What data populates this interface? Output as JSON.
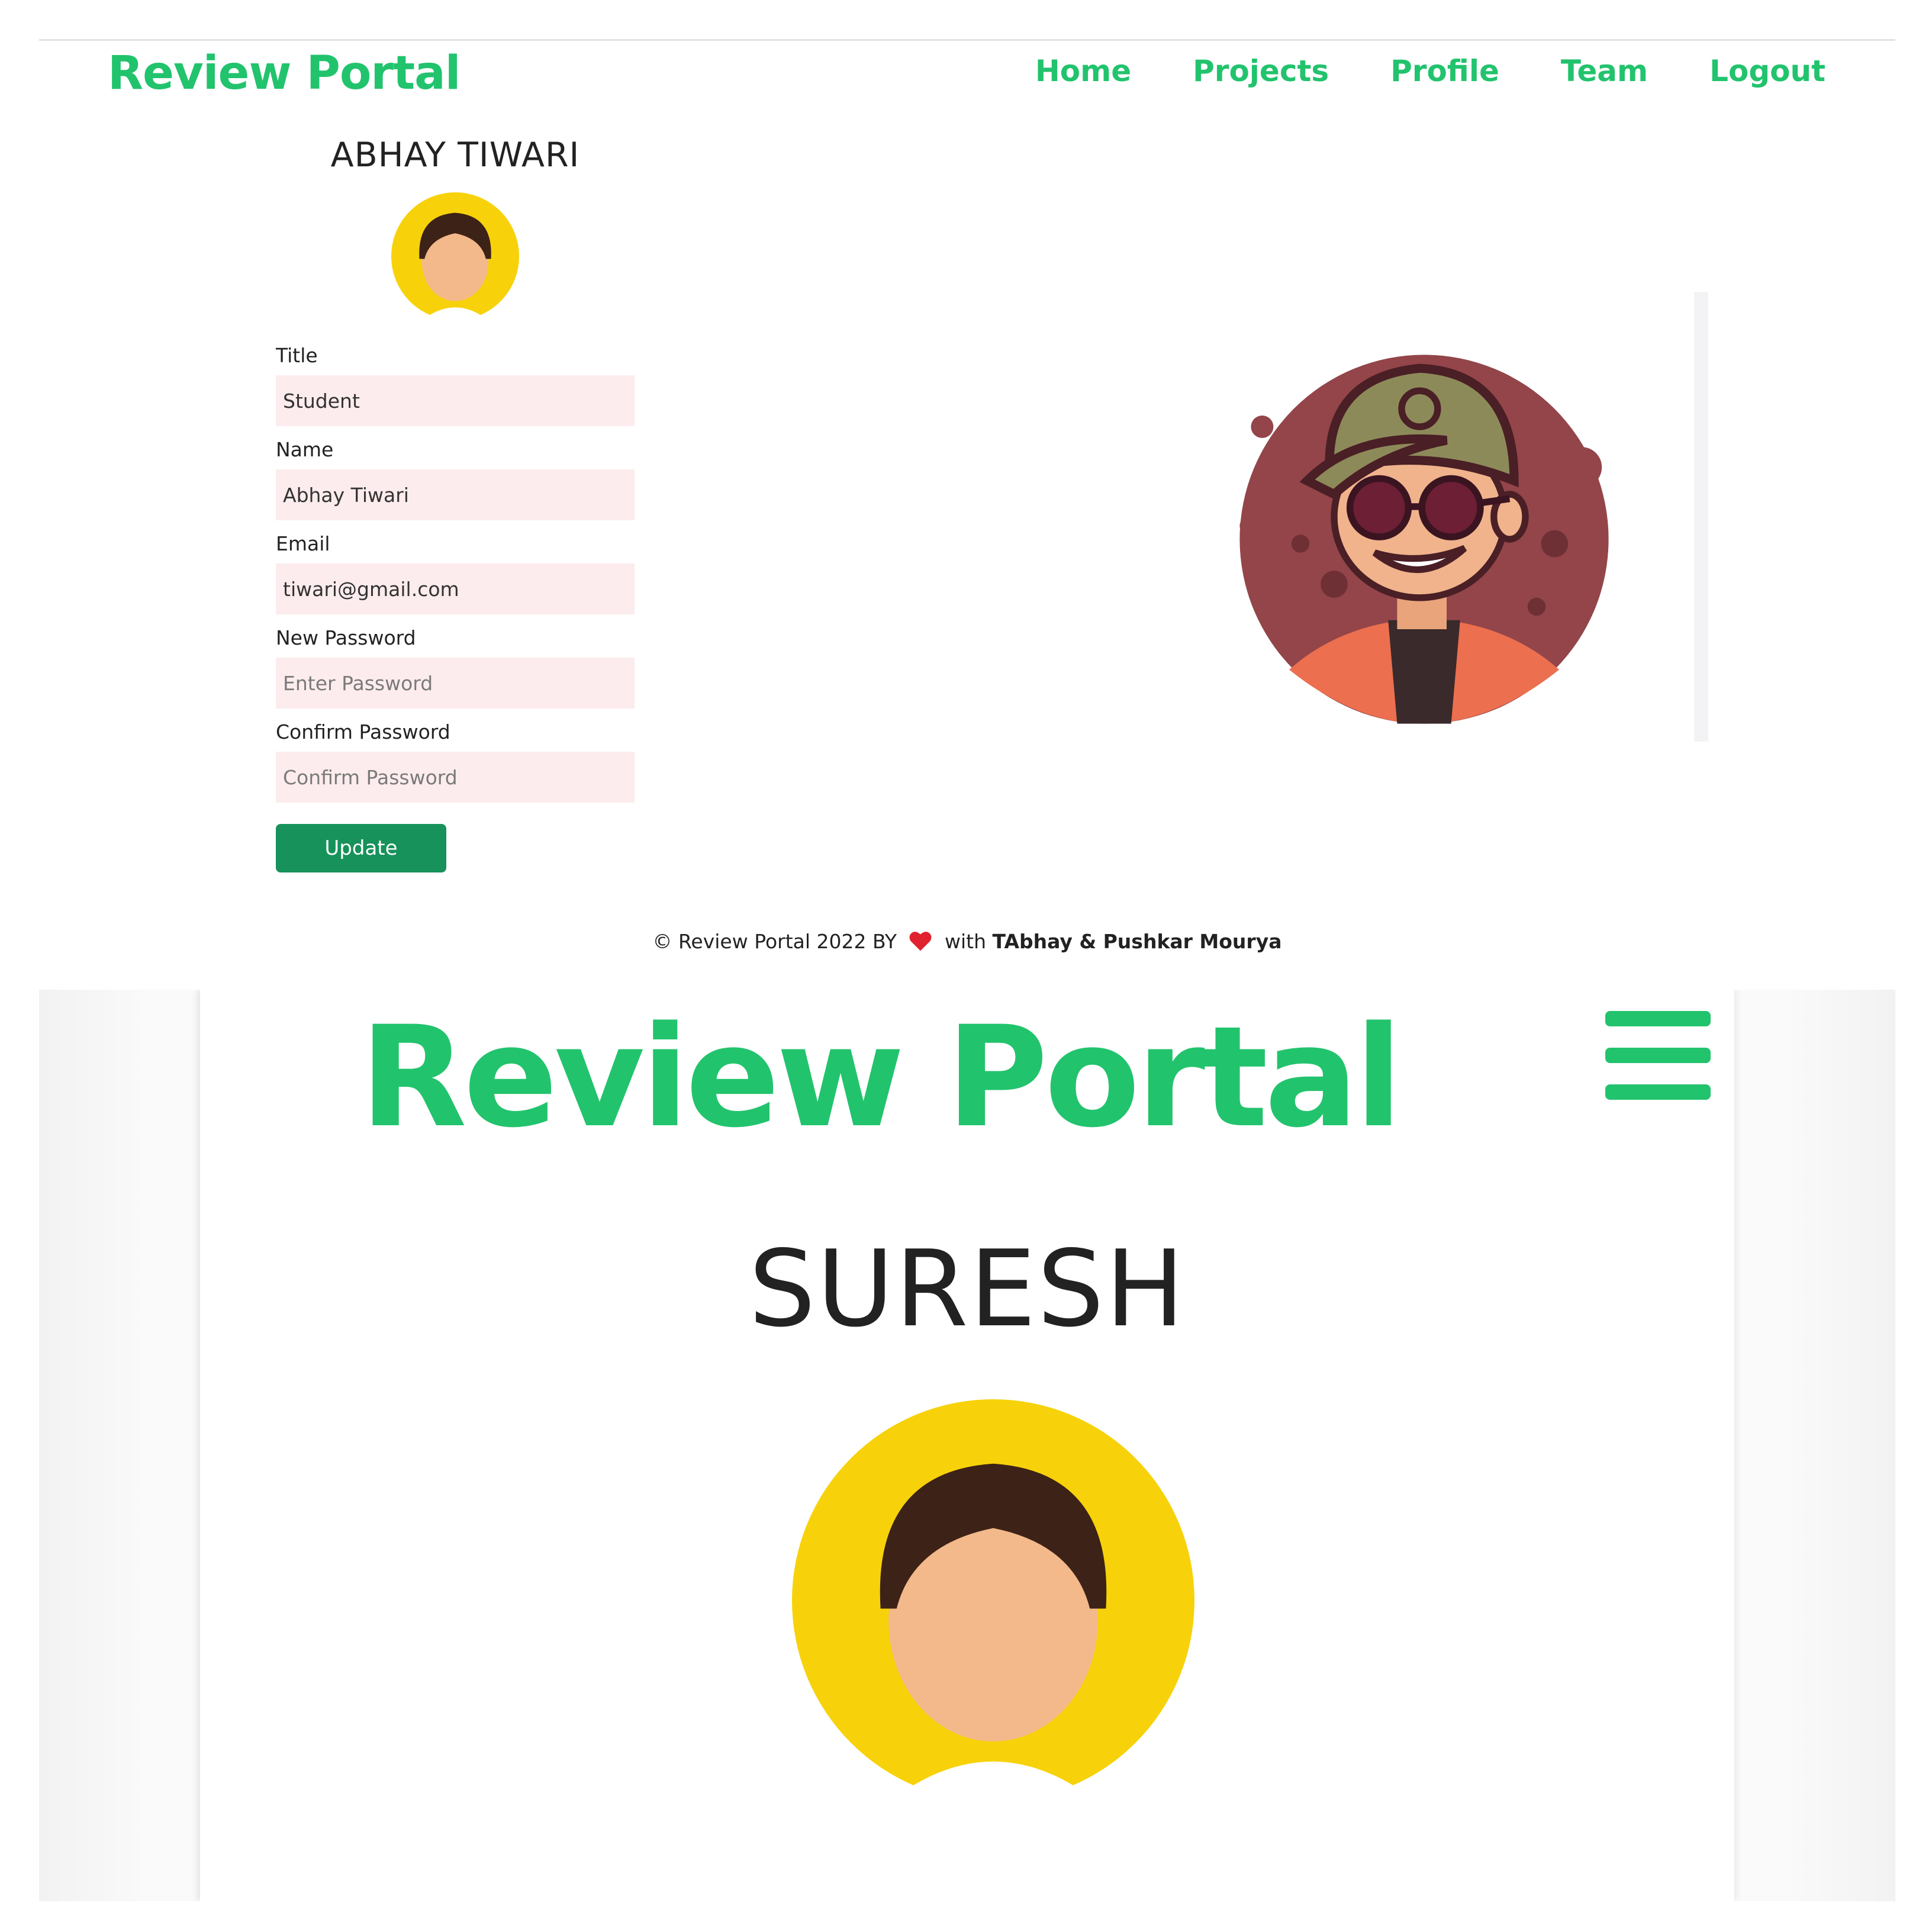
{
  "app": {
    "logo": "Review Portal",
    "brand_color": "#22c36d"
  },
  "nav": {
    "items": [
      {
        "label": "Home"
      },
      {
        "label": "Projects"
      },
      {
        "label": "Profile"
      },
      {
        "label": "Team"
      },
      {
        "label": "Logout"
      }
    ]
  },
  "profile": {
    "name": "ABHAY TIWARI",
    "avatar_icon": "user-avatar-icon",
    "fields": {
      "title": {
        "label": "Title",
        "value": "Student",
        "placeholder": ""
      },
      "name": {
        "label": "Name",
        "value": "Abhay Tiwari",
        "placeholder": ""
      },
      "email": {
        "label": "Email",
        "value": "tiwari@gmail.com",
        "placeholder": ""
      },
      "new_password": {
        "label": "New Password",
        "value": "",
        "placeholder": "Enter Password"
      },
      "confirm_password": {
        "label": "Confirm Password",
        "value": "",
        "placeholder": "Confirm Password"
      }
    },
    "update_label": "Update",
    "button_color": "#16925a",
    "input_bg": "#fdeced"
  },
  "hero": {
    "illustration": "cartoon-character-illustration"
  },
  "footer": {
    "prefix": "© Review Portal 2022  BY",
    "with": "with",
    "authors": "TAbhay & Pushkar Mourya",
    "heart_icon": "heart-icon"
  },
  "mobile": {
    "logo": "Review Portal",
    "menu_icon": "hamburger-menu-icon",
    "name": "SURESH",
    "avatar_icon": "user-avatar-icon"
  }
}
